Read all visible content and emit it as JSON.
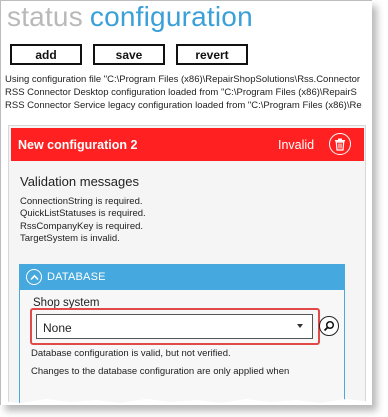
{
  "header": {
    "title_part1": "status",
    "title_part2": "configuration"
  },
  "toolbar": {
    "add_label": "add",
    "save_label": "save",
    "revert_label": "revert"
  },
  "log": {
    "lines": [
      "Using configuration file \"C:\\Program Files (x86)\\RepairShopSolutions\\Rss.Connector",
      "RSS Connector Desktop configuration loaded from \"C:\\Program Files (x86)\\RepairS",
      "RSS Connector Service legacy configuration loaded from \"C:\\Program Files (x86)\\Re"
    ]
  },
  "config": {
    "title": "New configuration 2",
    "status": "Invalid",
    "colors": {
      "error_header": "#ff2121",
      "section_header": "#45a8de",
      "highlight": "#e24a4a"
    },
    "validation": {
      "title": "Validation messages",
      "messages": [
        "ConnectionString is required.",
        "QuickListStatuses is required.",
        "RssCompanyKey is required.",
        "TargetSystem is invalid."
      ]
    },
    "database": {
      "section_title": "DATABASE",
      "shop_system_label": "Shop system",
      "shop_system_value": "None",
      "status_text": "Database configuration is valid, but not verified.",
      "note_text": "Changes to the database configuration are only applied when"
    }
  },
  "icons": [
    "trash-icon",
    "chevron-up-icon",
    "search-icon",
    "dropdown-arrow-icon"
  ]
}
